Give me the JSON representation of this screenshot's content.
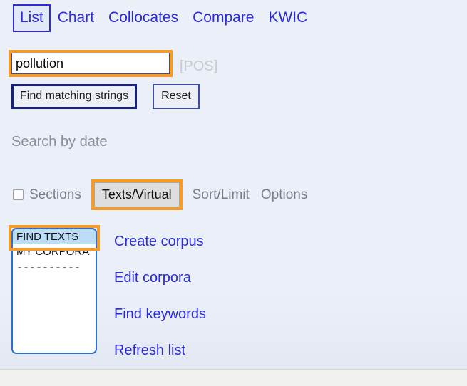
{
  "nav": {
    "tabs": [
      {
        "label": "List",
        "selected": true
      },
      {
        "label": "Chart",
        "selected": false
      },
      {
        "label": "Collocates",
        "selected": false
      },
      {
        "label": "Compare",
        "selected": false
      },
      {
        "label": "KWIC",
        "selected": false
      }
    ]
  },
  "search": {
    "query_value": "pollution",
    "query_placeholder": "",
    "pos_label": "[POS]",
    "find_button": "Find matching strings",
    "reset_button": "Reset",
    "search_by_date": "Search by date"
  },
  "options": {
    "sections_label": "Sections",
    "sections_checked": false,
    "texts_virtual_label": "Texts/Virtual",
    "sort_limit_label": "Sort/Limit",
    "options_label": "Options"
  },
  "corpus_list": {
    "items": [
      {
        "label": "FIND TEXTS",
        "selected": true
      },
      {
        "label": "MY CORPORA",
        "selected": false
      }
    ],
    "separator": "----------"
  },
  "actions": [
    {
      "label": "Create corpus"
    },
    {
      "label": "Edit corpora"
    },
    {
      "label": "Find keywords"
    },
    {
      "label": "Refresh list"
    }
  ],
  "colors": {
    "page_background": "#eaeff8",
    "link_blue": "#2b2bdd",
    "highlight_orange": "#f59b27",
    "selection_blue": "#bddcf5",
    "muted_gray": "#797d85",
    "border_navy": "#16227c"
  }
}
